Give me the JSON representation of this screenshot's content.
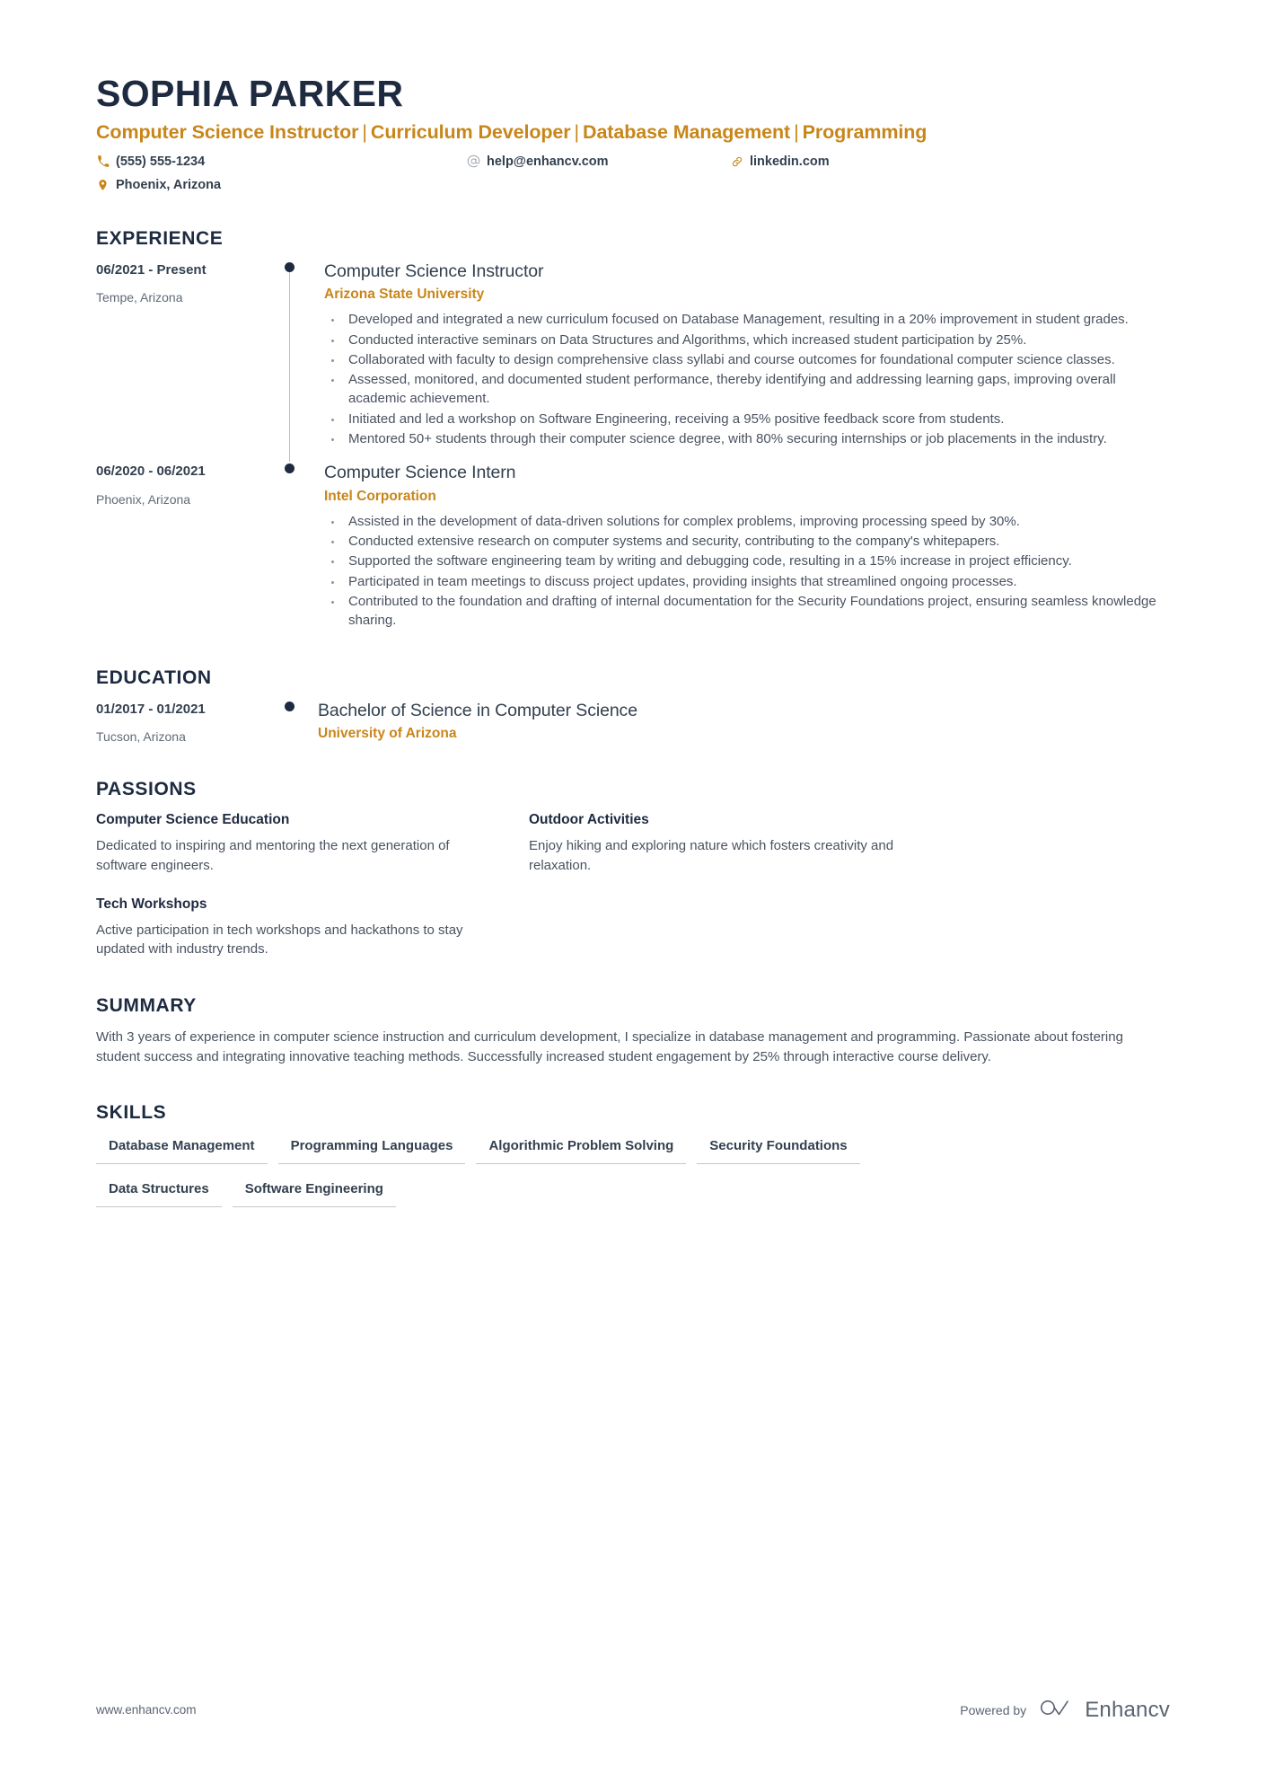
{
  "header": {
    "full_name": "SOPHIA PARKER",
    "headline_parts": [
      "Computer Science Instructor",
      "Curriculum Developer",
      "Database Management",
      "Programming"
    ],
    "headline_separator": "|",
    "accent_color": "#c8861a",
    "name_color": "#1d2a40",
    "contact": {
      "phone": "(555) 555-1234",
      "email": "help@enhancv.com",
      "linkedin": "linkedin.com",
      "location": "Phoenix, Arizona",
      "phone_icon": "phone-icon",
      "email_icon": "at-sign-icon",
      "linkedin_icon": "link-icon",
      "location_icon": "map-pin-icon"
    }
  },
  "sections": {
    "experience": {
      "title": "EXPERIENCE",
      "entries": [
        {
          "date": "06/2021 - Present",
          "location": "Tempe, Arizona",
          "role": "Computer Science Instructor",
          "organization": "Arizona State University",
          "bullets": [
            "Developed and integrated a new curriculum focused on Database Management, resulting in a 20% improvement in student grades.",
            "Conducted interactive seminars on Data Structures and Algorithms, which increased student participation by 25%.",
            "Collaborated with faculty to design comprehensive class syllabi and course outcomes for foundational computer science classes.",
            "Assessed, monitored, and documented student performance, thereby identifying and addressing learning gaps, improving overall academic achievement.",
            "Initiated and led a workshop on Software Engineering, receiving a 95% positive feedback score from students.",
            "Mentored 50+ students through their computer science degree, with 80% securing internships or job placements in the industry."
          ]
        },
        {
          "date": "06/2020 - 06/2021",
          "location": "Phoenix, Arizona",
          "role": "Computer Science Intern",
          "organization": "Intel Corporation",
          "bullets": [
            "Assisted in the development of data-driven solutions for complex problems, improving processing speed by 30%.",
            "Conducted extensive research on computer systems and security, contributing to the company's whitepapers.",
            "Supported the software engineering team by writing and debugging code, resulting in a 15% increase in project efficiency.",
            "Participated in team meetings to discuss project updates, providing insights that streamlined ongoing processes.",
            "Contributed to the foundation and drafting of internal documentation for the Security Foundations project, ensuring seamless knowledge sharing."
          ]
        }
      ]
    },
    "education": {
      "title": "EDUCATION",
      "entries": [
        {
          "date": "01/2017 - 01/2021",
          "location": "Tucson, Arizona",
          "degree": "Bachelor of Science in Computer Science",
          "institution": "University of Arizona"
        }
      ]
    },
    "passions": {
      "title": "PASSIONS",
      "items": [
        {
          "title": "Computer Science Education",
          "description": "Dedicated to inspiring and mentoring the next generation of software engineers."
        },
        {
          "title": "Outdoor Activities",
          "description": "Enjoy hiking and exploring nature which fosters creativity and relaxation."
        },
        {
          "title": "Tech Workshops",
          "description": "Active participation in tech workshops and hackathons to stay updated with industry trends."
        }
      ]
    },
    "summary": {
      "title": "SUMMARY",
      "text": "With 3 years of experience in computer science instruction and curriculum development, I specialize in database management and programming. Passionate about fostering student success and integrating innovative teaching methods. Successfully increased student engagement by 25% through interactive course delivery."
    },
    "skills": {
      "title": "SKILLS",
      "rows": [
        [
          "Database Management",
          "Programming Languages",
          "Algorithmic Problem Solving",
          "Security Foundations"
        ],
        [
          "Data Structures",
          "Software Engineering"
        ]
      ]
    }
  },
  "footer": {
    "url": "www.enhancv.com",
    "powered_by": "Powered by",
    "brand_name": "Enhancv",
    "brand_logo_icon": "enhancv-logo-icon"
  }
}
